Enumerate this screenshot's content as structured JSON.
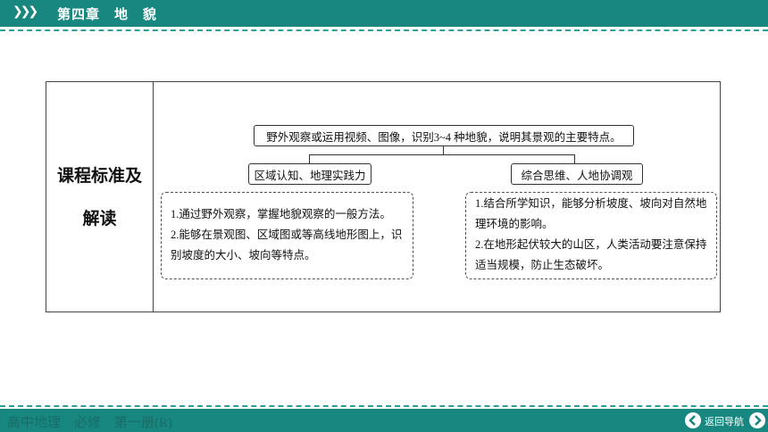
{
  "header": {
    "chevrons": "❯❯❯",
    "title": "第四章　地　貌"
  },
  "card": {
    "left_label_line1": "课程标准及",
    "left_label_line2": "解读",
    "top_box": "野外观察或运用视频、图像，识别3~4 种地貌，说明其景观的主要特点。",
    "mid_left": "区域认知、地理实践力",
    "mid_right": "综合思维、人地协调观",
    "left_items": [
      "1.通过野外观察，掌握地貌观察的一般方法。",
      "2.能够在景观图、区域图或等高线地形图上，识",
      "别坡度的大小、坡向等特点。"
    ],
    "right_items": [
      "1.结合所学知识，能够分析坡度、坡向对自然地",
      "理环境的影响。",
      "2.在地形起伏较大的山区，人类活动要注意保持",
      "适当规模，防止生态破坏。"
    ]
  },
  "footer": {
    "book": "高中地理　必修　第一册(R)",
    "nav_label": "返回导航",
    "prev_icon": "arrow-left-icon",
    "next_icon": "arrow-right-icon"
  },
  "colors": {
    "teal": "#17877f",
    "dash": "#2aa198"
  }
}
